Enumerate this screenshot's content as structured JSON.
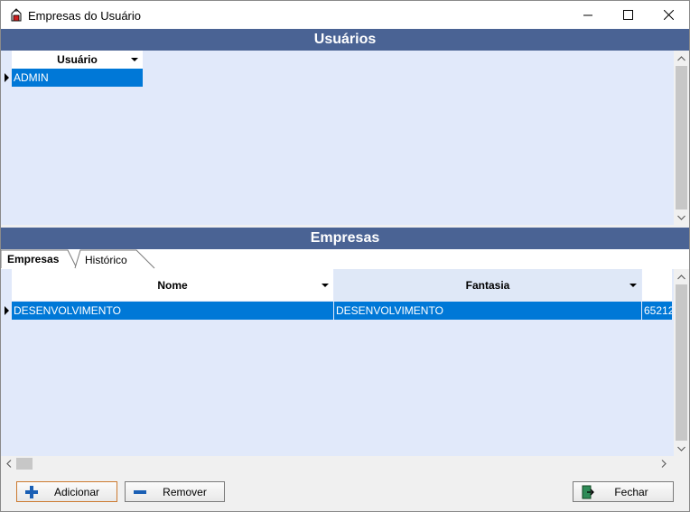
{
  "window": {
    "title": "Empresas do Usuário"
  },
  "users_section": {
    "header": "Usuários",
    "column_header": "Usuário",
    "rows": [
      "ADMIN"
    ]
  },
  "companies_section": {
    "header": "Empresas",
    "tabs": [
      {
        "label": "Empresas",
        "active": true
      },
      {
        "label": "Histórico",
        "active": false
      }
    ],
    "columns": [
      "Nome",
      "Fantasia"
    ],
    "rows": [
      {
        "nome": "DESENVOLVIMENTO",
        "fantasia": "DESENVOLVIMENTO",
        "extra": "65212"
      }
    ]
  },
  "buttons": {
    "add": "Adicionar",
    "remove": "Remover",
    "close": "Fechar"
  },
  "colors": {
    "header_bg": "#4a6394",
    "panel_bg": "#e1e9fa",
    "selection": "#0078d7"
  }
}
